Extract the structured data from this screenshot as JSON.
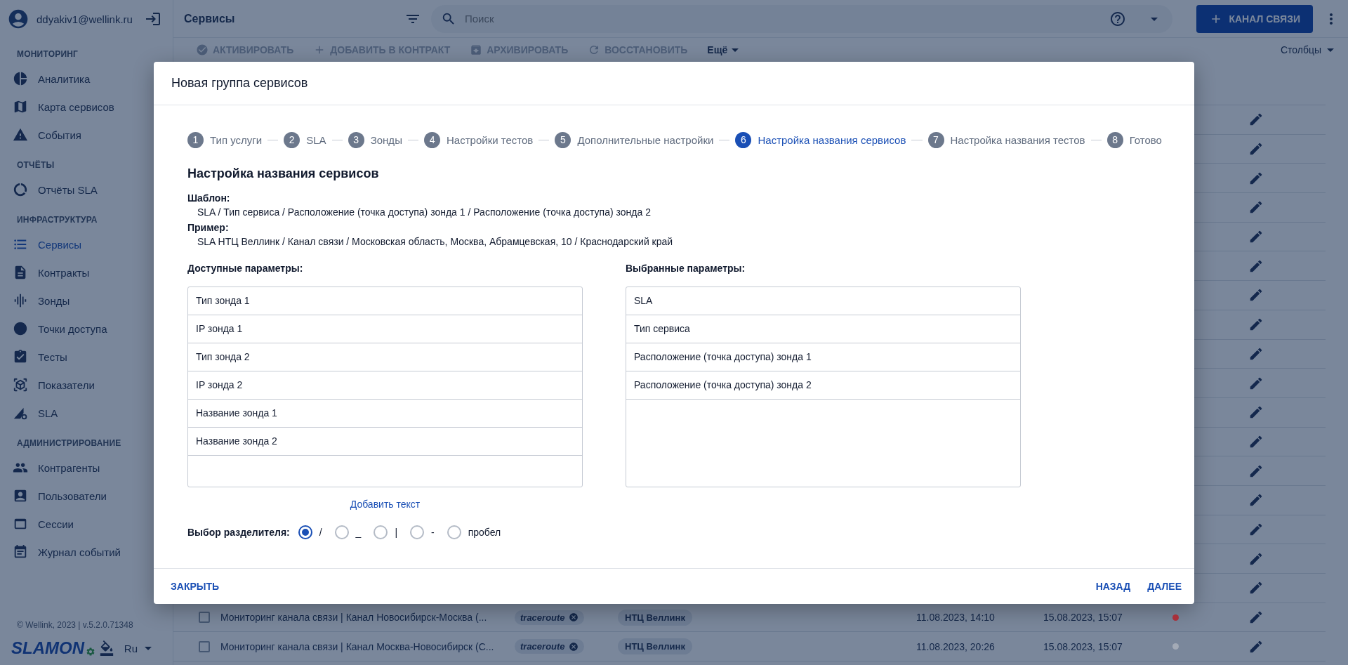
{
  "sidebar": {
    "user": {
      "email": "ddyakiv1@wellink.ru"
    },
    "sections": [
      {
        "title": "МОНИТОРИНГ",
        "items": [
          {
            "label": "Аналитика",
            "selected": false
          },
          {
            "label": "Карта сервисов",
            "selected": false
          },
          {
            "label": "События",
            "selected": false
          }
        ]
      },
      {
        "title": "ОТЧЁТЫ",
        "items": [
          {
            "label": "Отчёты SLA",
            "selected": false
          }
        ]
      },
      {
        "title": "ИНФРАСТРУКТУРА",
        "items": [
          {
            "label": "Сервисы",
            "selected": true
          },
          {
            "label": "Контракты",
            "selected": false
          },
          {
            "label": "Зонды",
            "selected": false
          },
          {
            "label": "Точки доступа",
            "selected": false
          },
          {
            "label": "Тесты",
            "selected": false
          },
          {
            "label": "Показатели",
            "selected": false
          },
          {
            "label": "SLA",
            "selected": false
          }
        ]
      },
      {
        "title": "АДМИНИСТРИРОВАНИЕ",
        "items": [
          {
            "label": "Контрагенты",
            "selected": false
          },
          {
            "label": "Пользователи",
            "selected": false
          },
          {
            "label": "Сессии",
            "selected": false
          },
          {
            "label": "Журнал событий",
            "selected": false
          }
        ]
      }
    ],
    "footer": {
      "copyright": "© Wellink, 2023 | v.5.2.0.71348",
      "logo": "SLAMON",
      "language": "Ru"
    }
  },
  "topbar": {
    "title": "Сервисы",
    "search_placeholder": "Поиск",
    "action_button": "КАНАЛ СВЯЗИ"
  },
  "toolbar": {
    "actions": [
      {
        "label": "АКТИВИРОВАТЬ",
        "disabled": true
      },
      {
        "label": "ДОБАВИТЬ В КОНТРАКТ",
        "disabled": true
      },
      {
        "label": "АРХИВИРОВАТЬ",
        "disabled": true
      },
      {
        "label": "ВОССТАНОВИТЬ",
        "disabled": true
      },
      {
        "label": "Ещё",
        "disabled": false
      }
    ],
    "columns_button": "Столбцы"
  },
  "table": {
    "rows": [
      {
        "checked": false,
        "name": "Мониторинг канала связи | Канал Новосибирск-Москва (...",
        "tag": "traceroute",
        "org": "НТЦ Веллинк",
        "created": "11.08.2023, 14:10",
        "updated": "15.08.2023, 15:07",
        "color": "#a8303a"
      },
      {
        "checked": false,
        "name": "Мониторинг канала связи | Канал Москва-Новосибирск (С...",
        "tag": "traceroute",
        "org": "НТЦ Веллинк",
        "created": "11.08.2023, 20:26",
        "updated": "15.08.2023, 15:07",
        "color": "#a3aab6"
      }
    ]
  },
  "dialog": {
    "title": "Новая группа сервисов",
    "steps": [
      {
        "number": "1",
        "label": "Тип услуги",
        "selected": false
      },
      {
        "number": "2",
        "label": "SLA",
        "selected": false
      },
      {
        "number": "3",
        "label": "Зонды",
        "selected": false
      },
      {
        "number": "4",
        "label": "Настройки тестов",
        "selected": false
      },
      {
        "number": "5",
        "label": "Дополнительные настройки",
        "selected": false
      },
      {
        "number": "6",
        "label": "Настройка названия сервисов",
        "selected": true
      },
      {
        "number": "7",
        "label": "Настройка названия тестов",
        "selected": false
      },
      {
        "number": "8",
        "label": "Готово",
        "selected": false
      }
    ],
    "heading": "Настройка названия сервисов",
    "template": {
      "label": "Шаблон:",
      "value": "SLA / Тип сервиса / Расположение (точка доступа) зонда 1 / Расположение (точка доступа) зонда 2"
    },
    "example": {
      "label": "Пример:",
      "value": "SLA НТЦ Веллинк / Канал связи / Московская область, Москва, Абрамцевская, 10 / Краснодарский край"
    },
    "available": {
      "title": "Доступные параметры:",
      "items": [
        "Тип зонда 1",
        "IP зонда 1",
        "Тип зонда 2",
        "IP зонда 2",
        "Название зонда 1",
        "Название зонда 2"
      ]
    },
    "chosen": {
      "title": "Выбранные параметры:",
      "items": [
        "SLA",
        "Тип сервиса",
        "Расположение (точка доступа) зонда 1",
        "Расположение (точка доступа) зонда 2"
      ]
    },
    "add_text_link": "Добавить текст",
    "separator": {
      "label": "Выбор разделителя:",
      "options": [
        {
          "label": "/",
          "selected": true
        },
        {
          "label": "_",
          "selected": false
        },
        {
          "label": "|",
          "selected": false
        },
        {
          "label": "-",
          "selected": false
        },
        {
          "label": "пробел",
          "selected": false
        }
      ]
    },
    "footer": {
      "close": "ЗАКРЫТЬ",
      "back": "НАЗАД",
      "next": "ДАЛЕЕ"
    }
  }
}
